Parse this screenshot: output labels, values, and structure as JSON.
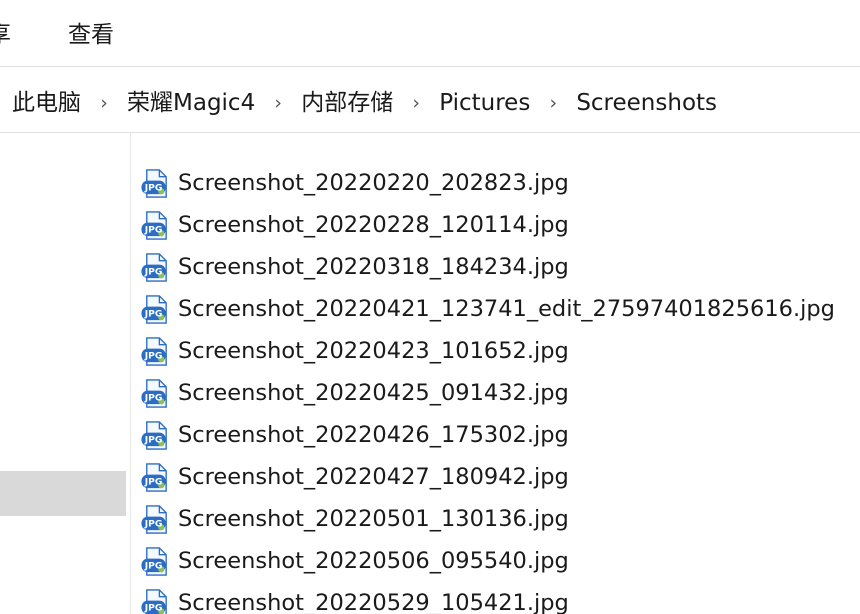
{
  "ribbon": {
    "tabs": [
      {
        "label": "享"
      },
      {
        "label": "查看"
      }
    ]
  },
  "address": {
    "separator": "›",
    "crumbs": [
      "此电脑",
      "荣耀Magic4",
      "内部存储",
      "Pictures",
      "Screenshots"
    ]
  },
  "icons": {
    "file_icon": "jpg-file-icon",
    "icon_text": "JPG",
    "icon_color": "#2b6cc4"
  },
  "files": [
    "Screenshot_20220220_202823.jpg",
    "Screenshot_20220228_120114.jpg",
    "Screenshot_20220318_184234.jpg",
    "Screenshot_20220421_123741_edit_27597401825616.jpg",
    "Screenshot_20220423_101652.jpg",
    "Screenshot_20220425_091432.jpg",
    "Screenshot_20220426_175302.jpg",
    "Screenshot_20220427_180942.jpg",
    "Screenshot_20220501_130136.jpg",
    "Screenshot_20220506_095540.jpg",
    "Screenshot_20220529_105421.jpg"
  ]
}
